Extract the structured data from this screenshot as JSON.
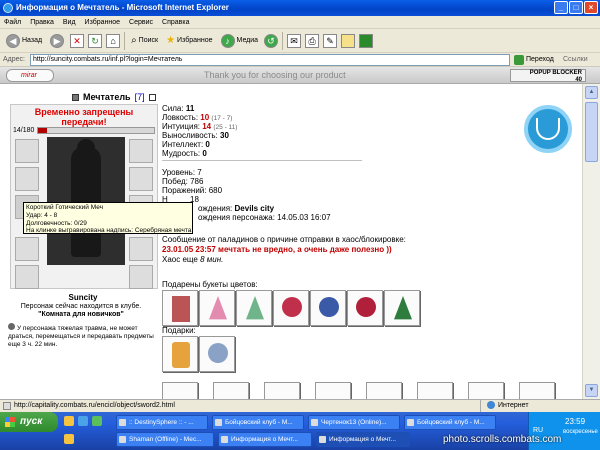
{
  "window": {
    "title": "Информация о Мечтатель - Microsoft Internet Explorer",
    "minimize": "_",
    "maximize": "□",
    "close": "×"
  },
  "menu": [
    "Файл",
    "Правка",
    "Вид",
    "Избранное",
    "Сервис",
    "Справка"
  ],
  "toolbar": {
    "back": "Назад",
    "search": "Поиск",
    "favorites": "Избранное",
    "media": "Медиа"
  },
  "address": {
    "label": "Адрес:",
    "url": "http://suncity.combats.ru/inf.pl?login=Мечтатель",
    "go": "Переход",
    "links": "Ссылки"
  },
  "banner": {
    "logo": "mirar",
    "slogan": "Thank you for choosing our product",
    "popup_blocker": "POPUP BLOCKER",
    "popup_count": "40"
  },
  "character": {
    "name": "Мечтатель",
    "level": "[7]",
    "warning": "Временно запрещены передачи!",
    "hp_text": "14/180",
    "hp_fraction": 0.078,
    "display_name": "Suncity",
    "location_text": "Персонаж сейчас находится в клубе.",
    "location_room": "\"Комната для новичков\"",
    "trauma": "У персонажа тяжелая травма, не может драться, перемещаться и передавать предметы еще 3 ч. 22 мин."
  },
  "tooltip": {
    "line1": "Короткий Готический Меч",
    "line2": "Удар: 4 - 8",
    "line3": "Долговечность: 0/29",
    "line4": "На клинке выгравирована надпись: Серебряная мечта"
  },
  "stats": {
    "strength_label": "Сила:",
    "strength": "11",
    "agility_label": "Ловкость:",
    "agility": "10",
    "agility_extra": "(17 - 7)",
    "intuition_label": "Интуиция:",
    "intuition": "14",
    "intuition_extra": "(25 - 11)",
    "endurance_label": "Выносливость:",
    "endurance": "30",
    "intellect_label": "Интеллект:",
    "intellect": "0",
    "wisdom_label": "Мудрость:",
    "wisdom": "0"
  },
  "info": {
    "level_label": "Уровень:",
    "level": "7",
    "wins_label": "Побед:",
    "wins": "786",
    "losses_label": "Поражений:",
    "losses": "680",
    "draws_label": "Н",
    "draws": "18",
    "birth_label": "ождения:",
    "birth_city": "Devils city",
    "reg_label": "ождения персонажа:",
    "reg_date": "14.05.03 16:07"
  },
  "message": {
    "line1": "Сообщение от паладинов о причине отправки в хаос/блокировке:",
    "line2": "23.01.05 23:57 мечтать не вредно, а очень даже полезно ))",
    "line3_prefix": "Хаос еще",
    "line3_value": "8 мин."
  },
  "bouquets_label": "Подарены букеты цветов:",
  "gifts_label": "Подарки:",
  "statusbar": {
    "url": "http://capitality.combats.ru/encicl/object/sword2.html",
    "zone": "Интернет"
  },
  "taskbar": {
    "start": "пуск",
    "tasks": [
      ":: DestinySphere :: - ...",
      "Бойцовский клуб - М...",
      "Чертенок13 (Online)...",
      "Бойцовский клуб - М...",
      "Shaman (Offline) - Мес...",
      "Информация о Мечт...",
      "Информация о Мечт..."
    ],
    "time": "23:59",
    "day": "воскресенье",
    "lang": "RU"
  },
  "watermark": "photo.scrolls.combats.com",
  "colors": {
    "accent_red": "#c00000",
    "title_blue": "#0043c7",
    "taskbar_blue": "#245edb"
  }
}
